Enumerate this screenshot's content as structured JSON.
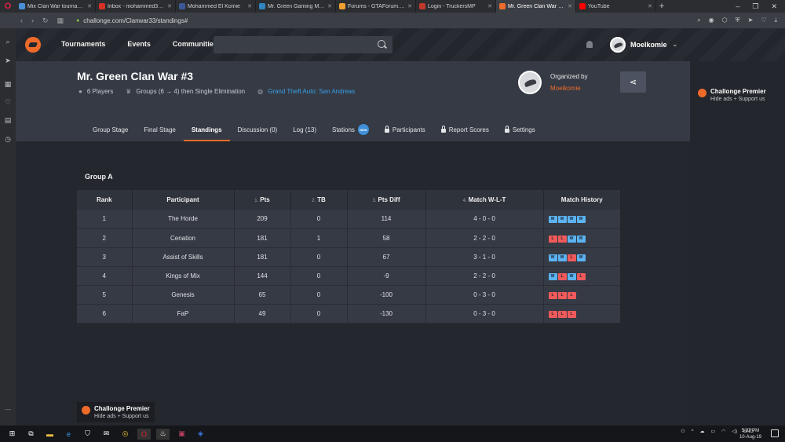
{
  "browser": {
    "tabs": [
      {
        "title": "Mix Clan War tournament c",
        "fav": "#4a90d9",
        "active": false
      },
      {
        "title": "Inbox - mohammed3103@",
        "fav": "#d93025",
        "active": false
      },
      {
        "title": "Mohammed El Komie",
        "fav": "#3b5998",
        "active": false
      },
      {
        "title": "Mr. Green Gaming MTA RP",
        "fav": "#2e86c1",
        "active": false
      },
      {
        "title": "Forums - GTAForum.nl - Ho",
        "fav": "#f0a030",
        "active": false
      },
      {
        "title": "Login - TruckersMP",
        "fav": "#c0392b",
        "active": false
      },
      {
        "title": "Mr. Green Clan War #3 - St",
        "fav": "#ee6b2a",
        "active": true
      },
      {
        "title": "YouTube",
        "fav": "#ff0000",
        "active": false
      }
    ],
    "url": "challonge.com/Clanwar33/standings#"
  },
  "header": {
    "nav": [
      "Tournaments",
      "Events",
      "Communities"
    ],
    "username": "Moelkomie"
  },
  "tournament": {
    "title": "Mr. Green Clan War #3",
    "players": "6 Players",
    "format": "Groups (6 → 4) then Single Elimination",
    "game": "Grand Theft Auto: San Andreas",
    "organized_by_label": "Organized by",
    "organizer": "Moelkomie"
  },
  "tabs": [
    {
      "label": "Group Stage",
      "locked": false,
      "active": false,
      "badge": ""
    },
    {
      "label": "Final Stage",
      "locked": false,
      "active": false,
      "badge": ""
    },
    {
      "label": "Standings",
      "locked": false,
      "active": true,
      "badge": ""
    },
    {
      "label": "Discussion (0)",
      "locked": false,
      "active": false,
      "badge": ""
    },
    {
      "label": "Log (13)",
      "locked": false,
      "active": false,
      "badge": ""
    },
    {
      "label": "Stations",
      "locked": false,
      "active": false,
      "badge": "NEW"
    },
    {
      "label": "Participants",
      "locked": true,
      "active": false,
      "badge": ""
    },
    {
      "label": "Report Scores",
      "locked": true,
      "active": false,
      "badge": ""
    },
    {
      "label": "Settings",
      "locked": true,
      "active": false,
      "badge": ""
    }
  ],
  "standings": {
    "group_title": "Group A",
    "columns": [
      {
        "num": "",
        "label": "Rank"
      },
      {
        "num": "",
        "label": "Participant"
      },
      {
        "num": "1.",
        "label": "Pts"
      },
      {
        "num": "2.",
        "label": "TB"
      },
      {
        "num": "3.",
        "label": "Pts Diff"
      },
      {
        "num": "4.",
        "label": "Match W-L-T"
      },
      {
        "num": "",
        "label": "Match History"
      }
    ],
    "rows": [
      {
        "rank": "1",
        "participant": "The Horde",
        "pts": "209",
        "tb": "0",
        "diff": "114",
        "wlt": "4 - 0 - 0",
        "history": [
          "W",
          "W",
          "W",
          "W"
        ]
      },
      {
        "rank": "2",
        "participant": "Cenation",
        "pts": "181",
        "tb": "1",
        "diff": "58",
        "wlt": "2 - 2 - 0",
        "history": [
          "L",
          "L",
          "W",
          "W"
        ]
      },
      {
        "rank": "3",
        "participant": "Assist of Skills",
        "pts": "181",
        "tb": "0",
        "diff": "67",
        "wlt": "3 - 1 - 0",
        "history": [
          "W",
          "W",
          "L",
          "W"
        ]
      },
      {
        "rank": "4",
        "participant": "Kings of Mix",
        "pts": "144",
        "tb": "0",
        "diff": "-9",
        "wlt": "2 - 2 - 0",
        "history": [
          "W",
          "L",
          "W",
          "L"
        ]
      },
      {
        "rank": "5",
        "participant": "Genesis",
        "pts": "65",
        "tb": "0",
        "diff": "-100",
        "wlt": "0 - 3 - 0",
        "history": [
          "L",
          "L",
          "L"
        ]
      },
      {
        "rank": "6",
        "participant": "FaP",
        "pts": "49",
        "tb": "0",
        "diff": "-130",
        "wlt": "0 - 3 - 0",
        "history": [
          "L",
          "L",
          "L"
        ]
      }
    ]
  },
  "promo": {
    "title": "Challonge Premier",
    "subtitle": "Hide ads + Support us"
  },
  "taskbar": {
    "lang": "ENG",
    "time": "5:27 PM",
    "date": "10-Aug-19"
  },
  "colors": {
    "accent": "#ee6b2a",
    "win": "#5cb3f2",
    "loss": "#f05a5a",
    "link": "#3aa0e8"
  }
}
